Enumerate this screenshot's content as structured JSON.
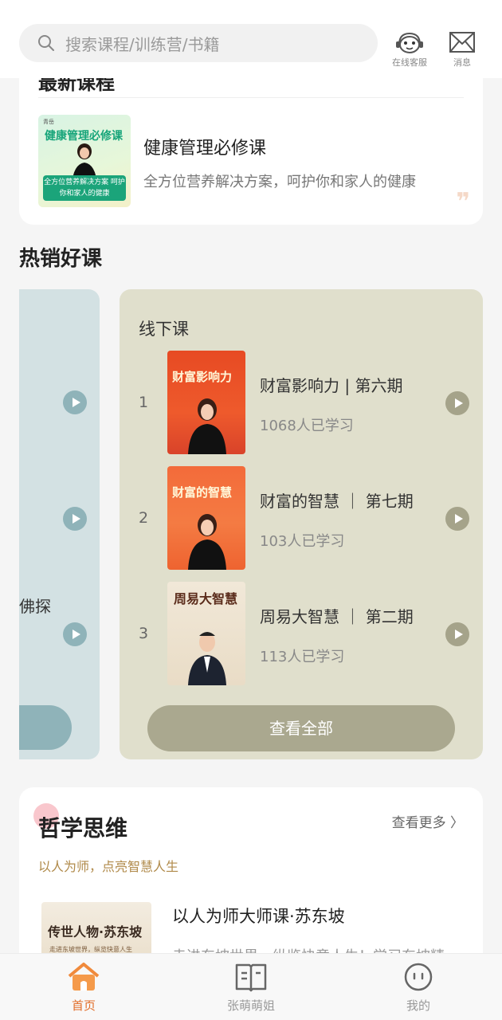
{
  "header": {
    "search_placeholder": "搜索课程/训练营/书籍",
    "service_label": "在线客服",
    "message_label": "消息"
  },
  "featured": {
    "cut_title": "最新课程",
    "course_title": "健康管理必修课",
    "course_desc": "全方位营养解决方案，呵护你和家人的健康",
    "thumb_brand": "青岳",
    "thumb_title": "健康管理必修课",
    "thumb_band": "全方位营养解决方案 呵护你和家人的健康",
    "quote_glyph": "❞"
  },
  "hot": {
    "section_title": "热销好课",
    "peek_text": "佛探",
    "offline": {
      "title": "线下课",
      "items": [
        {
          "rank": "1",
          "title": "财富影响力 | 第六期",
          "count": "1068人已学习",
          "cover_text": "财富影响力"
        },
        {
          "rank": "2",
          "title": "财富的智慧 ｜ 第七期",
          "count": "103人已学习",
          "cover_text": "财富的智慧"
        },
        {
          "rank": "3",
          "title": "周易大智慧 ｜ 第二期",
          "count": "113人已学习",
          "cover_text": "周易大智慧"
        }
      ],
      "view_all": "查看全部"
    }
  },
  "philosophy": {
    "title": "哲学思维",
    "more": "查看更多 〉",
    "subtitle": "以人为师，点亮智慧人生",
    "course_title": "以人为师大师课·苏东坡",
    "course_desc": "走进东坡世界，纵览快意人生！学习东坡精",
    "thumb_title": "传世人物·苏东坡",
    "thumb_sub": "走进东坡世界，纵览快意人生"
  },
  "tabbar": {
    "items": [
      {
        "label": "首页",
        "icon": "home-icon",
        "active": true
      },
      {
        "label": "张萌萌姐",
        "icon": "book-icon",
        "active": false
      },
      {
        "label": "我的",
        "icon": "profile-icon",
        "active": false
      }
    ]
  },
  "colors": {
    "accent": "#e26e2a",
    "offline_card": "#e0dfcc",
    "peek_card": "#d3e1e3"
  }
}
